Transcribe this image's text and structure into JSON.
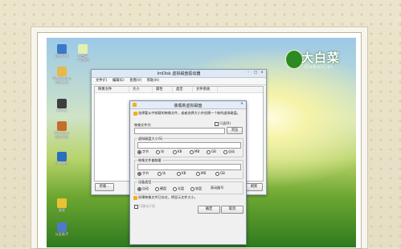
{
  "desktop": {
    "icons": [
      {
        "label": "我的电脑",
        "color": "#3a79c6"
      },
      {
        "label": "大白菜\n一键装机",
        "color": "#e2f1b1"
      },
      {
        "label": "DiskGenius\n分区工具",
        "color": "#e7b84a"
      },
      {
        "label": "CPU-Z",
        "color": "#3e3e3e"
      },
      {
        "label": "Windows\n密码清除",
        "color": "#c76d2b"
      },
      {
        "label": "外置程序",
        "color": "#2d6dc2"
      },
      {
        "label": "搜索",
        "color": "#e9c232"
      },
      {
        "label": "分区助手",
        "color": "#4f79c9"
      }
    ],
    "brand_big": "大白菜",
    "brand_small": "DaBaiCai"
  },
  "main_window": {
    "title": "ImDisk 虚拟磁盘驱动器",
    "menu": [
      "文件(F)",
      "编辑(E)",
      "查看(V)",
      "帮助(H)"
    ],
    "columns": [
      "映像文件",
      "大小",
      "属性",
      "类型",
      "文件系统"
    ],
    "buttons": {
      "mount": "装载...",
      "unmount": "卸载",
      "refresh": "刷新"
    }
  },
  "dialog": {
    "title": "装载新虚拟磁盘",
    "intro": "选择要从中装载的映像文件，或者选择大小并创建一个新的虚拟磁盘。",
    "image_label": "映像文件(I)",
    "browse": "浏览",
    "readonly_label": "只读(R)",
    "size_group": "虚拟磁盘大小(S)",
    "size_options": [
      "字节",
      "块",
      "KB",
      "MB",
      "GB",
      "自动"
    ],
    "offset_group": "映像文件偏移量",
    "offset_options": [
      "字节",
      "块",
      "KB",
      "MB",
      "GB"
    ],
    "drive_group": "设备类型",
    "drive_options": [
      "自动",
      "硬盘",
      "光盘",
      "软盘"
    ],
    "drive_letter_label": "驱动器号",
    "note": "如果映像文件已存在，将显示文件大小。",
    "removable": "可移动介质",
    "ok": "确定",
    "cancel": "取消"
  }
}
